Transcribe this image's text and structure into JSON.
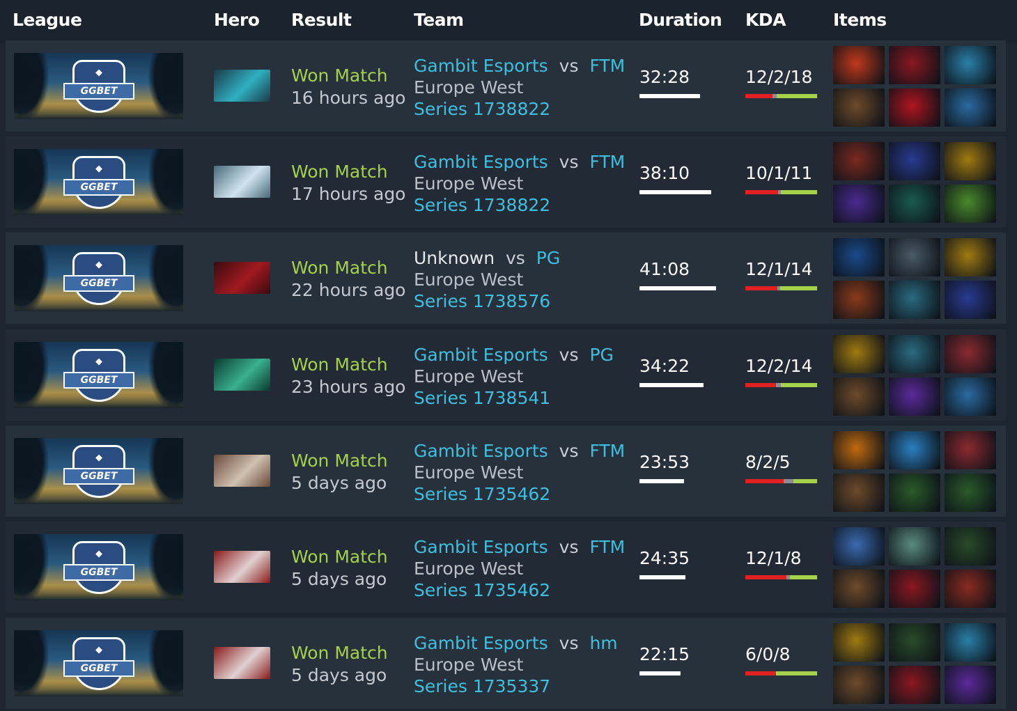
{
  "headers": {
    "league": "League",
    "hero": "Hero",
    "result": "Result",
    "team": "Team",
    "duration": "Duration",
    "kda": "KDA",
    "items": "Items"
  },
  "league_logo_text": "GGBET",
  "matches": [
    {
      "hero_icon": "hero-portrait-icon",
      "hero_colors": [
        "#1b3b4a",
        "#2fb0c0"
      ],
      "result": "Won Match",
      "time_ago": "16 hours ago",
      "team_a": "Gambit Esports",
      "team_a_linked": true,
      "vs": "vs",
      "team_b": "FTM",
      "region": "Europe West",
      "series": "Series 1738822",
      "duration": "32:28",
      "duration_fraction": 0.79,
      "kda": "12/2/18",
      "kda_values": [
        12,
        2,
        18
      ],
      "items": [
        {
          "icon": "fire-item-icon",
          "color": "#c0391b"
        },
        {
          "icon": "red-orb-item-icon",
          "color": "#8a1822"
        },
        {
          "icon": "blue-crystal-item-icon",
          "color": "#2a7fa8"
        },
        {
          "icon": "boots-item-icon",
          "color": "#6e4a2a"
        },
        {
          "icon": "red-gem-item-icon",
          "color": "#b01420"
        },
        {
          "icon": "staff-item-icon",
          "color": "#2a6aa0"
        }
      ]
    },
    {
      "hero_icon": "hero-portrait-icon",
      "hero_colors": [
        "#4a6a7a",
        "#d0e4ee"
      ],
      "result": "Won Match",
      "time_ago": "17 hours ago",
      "team_a": "Gambit Esports",
      "team_a_linked": true,
      "vs": "vs",
      "team_b": "FTM",
      "region": "Europe West",
      "series": "Series 1738822",
      "duration": "38:10",
      "duration_fraction": 0.94,
      "kda": "10/1/11",
      "kda_values": [
        10,
        1,
        11
      ],
      "items": [
        {
          "icon": "claw-item-icon",
          "color": "#7a2a20"
        },
        {
          "icon": "blue-scepter-item-icon",
          "color": "#2a3a90"
        },
        {
          "icon": "gold-helm-item-icon",
          "color": "#a07a10"
        },
        {
          "icon": "purple-boots-item-icon",
          "color": "#4a2a90"
        },
        {
          "icon": "ethereal-item-icon",
          "color": "#1a5a50"
        },
        {
          "icon": "green-drum-item-icon",
          "color": "#4a8a2a"
        }
      ]
    },
    {
      "hero_icon": "hero-portrait-icon",
      "hero_colors": [
        "#3a0a10",
        "#a01a20"
      ],
      "result": "Won Match",
      "time_ago": "22 hours ago",
      "team_a": "Unknown",
      "team_a_linked": false,
      "vs": "vs",
      "team_b": "PG",
      "region": "Europe West",
      "series": "Series 1738576",
      "duration": "41:08",
      "duration_fraction": 1.0,
      "kda": "12/1/14",
      "kda_values": [
        12,
        1,
        14
      ],
      "items": [
        {
          "icon": "blue-orb-item-icon",
          "color": "#1a4a8a"
        },
        {
          "icon": "mask-item-icon",
          "color": "#4a5a66"
        },
        {
          "icon": "gold-helm-item-icon",
          "color": "#a07a10"
        },
        {
          "icon": "red-boots-item-icon",
          "color": "#8a3a1a"
        },
        {
          "icon": "blade-item-icon",
          "color": "#2a6a80"
        },
        {
          "icon": "blue-scepter-item-icon",
          "color": "#2a3a90"
        }
      ]
    },
    {
      "hero_icon": "hero-portrait-icon",
      "hero_colors": [
        "#0a3a30",
        "#3ab090"
      ],
      "result": "Won Match",
      "time_ago": "23 hours ago",
      "team_a": "Gambit Esports",
      "team_a_linked": true,
      "vs": "vs",
      "team_b": "PG",
      "region": "Europe West",
      "series": "Series 1738541",
      "duration": "34:22",
      "duration_fraction": 0.84,
      "kda": "12/2/14",
      "kda_values": [
        12,
        2,
        14
      ],
      "items": [
        {
          "icon": "gold-helm-item-icon",
          "color": "#a07a10"
        },
        {
          "icon": "axe-item-icon",
          "color": "#2a6a80"
        },
        {
          "icon": "red-cloak-item-icon",
          "color": "#8a2a30"
        },
        {
          "icon": "boots-item-icon",
          "color": "#6e4a2a"
        },
        {
          "icon": "purple-crystal-item-icon",
          "color": "#5a2a9a"
        },
        {
          "icon": "staff-item-icon",
          "color": "#2a6aa0"
        }
      ]
    },
    {
      "hero_icon": "hero-portrait-icon",
      "hero_colors": [
        "#6a4a3a",
        "#d0c0b0"
      ],
      "result": "Won Match",
      "time_ago": "5 days ago",
      "team_a": "Gambit Esports",
      "team_a_linked": true,
      "vs": "vs",
      "team_b": "FTM",
      "region": "Europe West",
      "series": "Series 1735462",
      "duration": "23:53",
      "duration_fraction": 0.58,
      "kda": "8/2/5",
      "kda_values": [
        8,
        2,
        5
      ],
      "items": [
        {
          "icon": "flame-item-icon",
          "color": "#c06a10"
        },
        {
          "icon": "lightning-hammer-item-icon",
          "color": "#2a80c0"
        },
        {
          "icon": "red-cloak-item-icon",
          "color": "#8a2a30"
        },
        {
          "icon": "boots-item-icon",
          "color": "#6e4a2a"
        },
        {
          "icon": "green-claw-item-icon",
          "color": "#2a5a2a"
        },
        {
          "icon": "green-claw-item-icon",
          "color": "#2a5a2a"
        }
      ]
    },
    {
      "hero_icon": "hero-portrait-icon",
      "hero_colors": [
        "#8a1a1a",
        "#e0d0d0"
      ],
      "result": "Won Match",
      "time_ago": "5 days ago",
      "team_a": "Gambit Esports",
      "team_a_linked": true,
      "vs": "vs",
      "team_b": "FTM",
      "region": "Europe West",
      "series": "Series 1735462",
      "duration": "24:35",
      "duration_fraction": 0.6,
      "kda": "12/1/8",
      "kda_values": [
        12,
        1,
        8
      ],
      "items": [
        {
          "icon": "potion-item-icon",
          "color": "#3a6ab0"
        },
        {
          "icon": "wind-item-icon",
          "color": "#5a8a80"
        },
        {
          "icon": "wand-item-icon",
          "color": "#2a4a2a"
        },
        {
          "icon": "boots-item-icon",
          "color": "#6e4a2a"
        },
        {
          "icon": "red-orb-item-icon",
          "color": "#8a1822"
        },
        {
          "icon": "armor-item-icon",
          "color": "#8a2a20"
        }
      ]
    },
    {
      "hero_icon": "hero-portrait-icon",
      "hero_colors": [
        "#8a1a1a",
        "#e0d0d0"
      ],
      "result": "Won Match",
      "time_ago": "5 days ago",
      "team_a": "Gambit Esports",
      "team_a_linked": true,
      "vs": "vs",
      "team_b": "hm",
      "region": "Europe West",
      "series": "Series 1735337",
      "duration": "22:15",
      "duration_fraction": 0.54,
      "kda": "6/0/8",
      "kda_values": [
        6,
        0,
        8
      ],
      "items": [
        {
          "icon": "gold-helm-item-icon",
          "color": "#a07a10"
        },
        {
          "icon": "wand-item-icon",
          "color": "#2a4a2a"
        },
        {
          "icon": "blue-crystal-item-icon",
          "color": "#2a7fa8"
        },
        {
          "icon": "boots-item-icon",
          "color": "#6e4a2a"
        },
        {
          "icon": "red-orb-item-icon",
          "color": "#8a1822"
        },
        {
          "icon": "purple-crystal-item-icon",
          "color": "#5a2a9a"
        }
      ]
    }
  ]
}
